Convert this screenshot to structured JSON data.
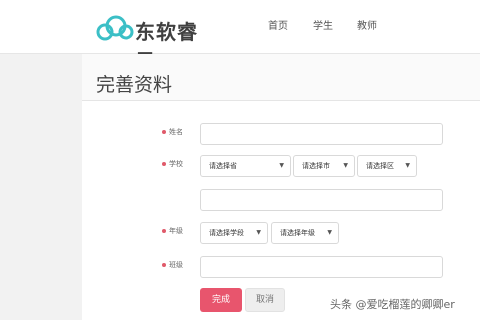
{
  "header": {
    "brand": "东软睿云",
    "nav": [
      "首页",
      "学生",
      "教师"
    ]
  },
  "page_title": "完善资料",
  "form": {
    "name_label": "姓名",
    "school_label": "学校",
    "province_select": "请选择省",
    "city_select": "请选择市",
    "district_select": "请选择区",
    "grade_label": "年级",
    "stage_select": "请选择学段",
    "grade_select": "请选择年级",
    "class_label": "班级"
  },
  "buttons": {
    "submit": "完成",
    "cancel": "取消"
  },
  "watermark": "头条 @爱吃榴莲的卿卿er",
  "colors": {
    "primary_button": "#e8556d",
    "required_marker": "#e05a6a",
    "logo_accent": "#3bbfc6"
  }
}
